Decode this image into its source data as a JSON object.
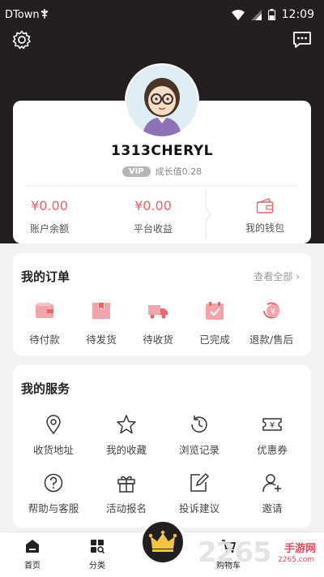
{
  "status_bar": {
    "carrier": "DTown",
    "time": "12:09"
  },
  "profile": {
    "username": "1313CHERYL",
    "vip_badge": "VIP",
    "growth": "成长值0.28",
    "account_balance": {
      "amount": "¥0.00",
      "label": "账户余额"
    },
    "platform_income": {
      "amount": "¥0.00",
      "label": "平台收益"
    },
    "wallet": {
      "label": "我的钱包"
    }
  },
  "orders": {
    "title": "我的订单",
    "view_all": "查看全部",
    "items": [
      {
        "label": "待付款",
        "icon": "wallet-icon"
      },
      {
        "label": "待发货",
        "icon": "box-icon"
      },
      {
        "label": "待收货",
        "icon": "truck-icon"
      },
      {
        "label": "已完成",
        "icon": "check-calendar-icon"
      },
      {
        "label": "退款/售后",
        "icon": "refund-icon"
      }
    ]
  },
  "services": {
    "title": "我的服务",
    "items": [
      {
        "label": "收货地址",
        "icon": "location-icon"
      },
      {
        "label": "我的收藏",
        "icon": "star-icon"
      },
      {
        "label": "浏览记录",
        "icon": "history-icon"
      },
      {
        "label": "优惠券",
        "icon": "coupon-icon"
      },
      {
        "label": "帮助与客服",
        "icon": "help-icon"
      },
      {
        "label": "活动报名",
        "icon": "gift-icon"
      },
      {
        "label": "投诉建议",
        "icon": "edit-icon"
      },
      {
        "label": "邀请",
        "icon": "add-user-icon"
      }
    ]
  },
  "bottom_nav": {
    "home": "首页",
    "category": "分类",
    "cart": "购物车"
  },
  "watermark": {
    "number": "2265",
    "brand": "手游网",
    "sub": "2265.com"
  },
  "colors": {
    "header_bg": "#231f20",
    "accent": "#e8656b",
    "crown": "#f5c242"
  }
}
